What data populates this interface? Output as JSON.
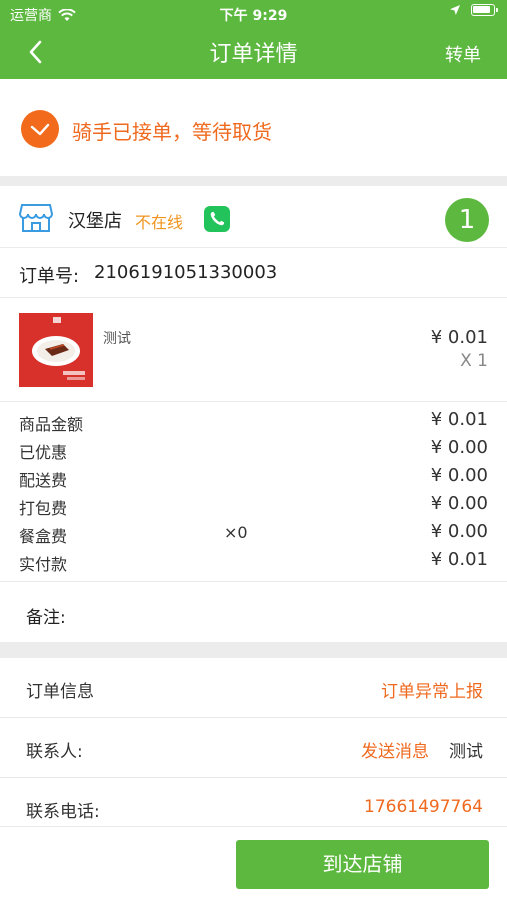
{
  "status_bar": {
    "carrier": "运营商",
    "time": "下午 9:29"
  },
  "nav": {
    "title": "订单详情",
    "action": "转单"
  },
  "status": {
    "text": "骑手已接单，等待取货",
    "accent": "#ef6a1f"
  },
  "store": {
    "name": "汉堡店",
    "status": "不在线",
    "count": "1"
  },
  "order": {
    "number_label": "订单号:",
    "number": "2106191051330003"
  },
  "product": {
    "name": "测试",
    "price": "¥ 0.01",
    "qty": "X 1"
  },
  "fees": [
    {
      "label": "商品金额",
      "mid": "",
      "value": "¥ 0.01"
    },
    {
      "label": "已优惠",
      "mid": "",
      "value": "¥ 0.00"
    },
    {
      "label": "配送费",
      "mid": "",
      "value": "¥ 0.00"
    },
    {
      "label": "打包费",
      "mid": "",
      "value": "¥ 0.00"
    },
    {
      "label": "餐盒费",
      "mid": "×0",
      "value": "¥ 0.00"
    },
    {
      "label": "实付款",
      "mid": "",
      "value": "¥ 0.01"
    }
  ],
  "remark": {
    "label": "备注:"
  },
  "info": {
    "order_info_label": "订单信息",
    "report_label": "订单异常上报",
    "contact_label": "联系人:",
    "send_message": "发送消息",
    "contact_name": "测试",
    "phone_label": "联系电话:",
    "phone": "17661497764"
  },
  "bottom": {
    "arrive_label": "到达店铺"
  },
  "colors": {
    "brand_green": "#5cb83f",
    "accent_orange": "#ef6a1f",
    "offline_orange": "#f0951f"
  }
}
